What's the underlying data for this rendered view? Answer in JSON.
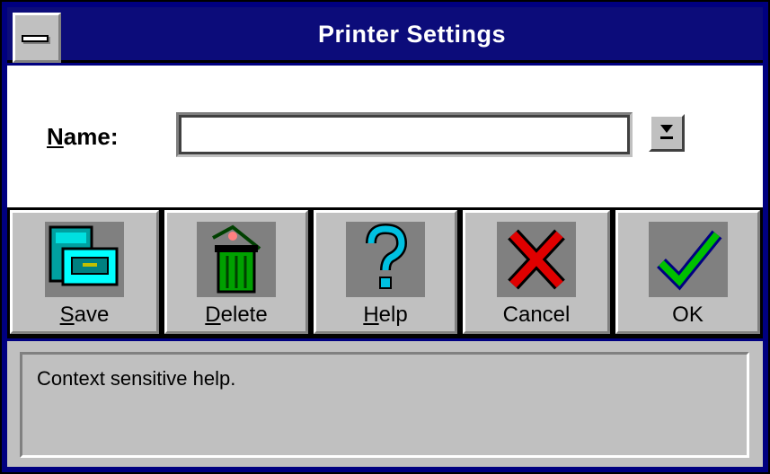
{
  "window": {
    "title": "Printer Settings"
  },
  "form": {
    "name_label_first": "N",
    "name_label_rest": "ame:",
    "name_value": ""
  },
  "toolbar": {
    "buttons": [
      {
        "underline": "S",
        "rest": "ave",
        "icon": "cabinet-save-icon"
      },
      {
        "underline": "D",
        "rest": "elete",
        "icon": "trash-can-icon"
      },
      {
        "underline": "H",
        "rest": "elp",
        "icon": "question-mark-icon"
      },
      {
        "underline": "",
        "rest": "Cancel",
        "icon": "red-x-icon"
      },
      {
        "underline": "",
        "rest": "OK",
        "icon": "green-check-icon"
      }
    ]
  },
  "status": {
    "text": "Context sensitive help."
  },
  "colors": {
    "title_bar": "#0c0c7a",
    "face": "#c0c0c0"
  }
}
